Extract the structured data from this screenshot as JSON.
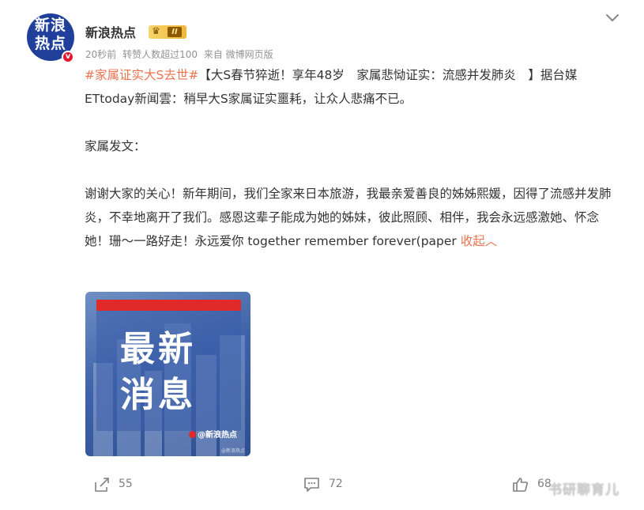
{
  "header": {
    "avatar_line1": "新浪",
    "avatar_line2": "热点",
    "username": "新浪热点",
    "vip_level": "II",
    "verified_mark": "v",
    "time": "20秒前",
    "repost_note": "转赞人数超过100",
    "source": "来自 微博网页版"
  },
  "post": {
    "hashtag": "#家属证实大S去世#",
    "line1_rest": "【大S春节猝逝！享年48岁　家属悲恸证实：流感并发肺炎　】据台媒ETtoday新闻雲：稍早大S家属证实噩耗，让众人悲痛不已。",
    "para2": "家属发文：",
    "para3": "谢谢大家的关心！新年期间，我们全家来日本旅游，我最亲爱善良的姊姊熙媛，因得了流感并发肺炎，不幸地离开了我们。感恩这辈子能成为她的姊妹，彼此照顾、相伴，我会永远感激她、怀念她！珊～一路好走！永远爱你 together remember forever(paper ",
    "collapse_label": "收起︿"
  },
  "image": {
    "headline_line1": "最新",
    "headline_line2": "消息",
    "source_label": "@新浪热点",
    "watermark": "@新浪热点"
  },
  "actions": {
    "repost_count": "55",
    "comment_count": "72",
    "like_count": "68"
  },
  "overlay_watermark": "书研聊育儿",
  "colors": {
    "accent": "#eb7350",
    "avatar_bg": "#1f3f9a",
    "verified": "#e6162d"
  }
}
